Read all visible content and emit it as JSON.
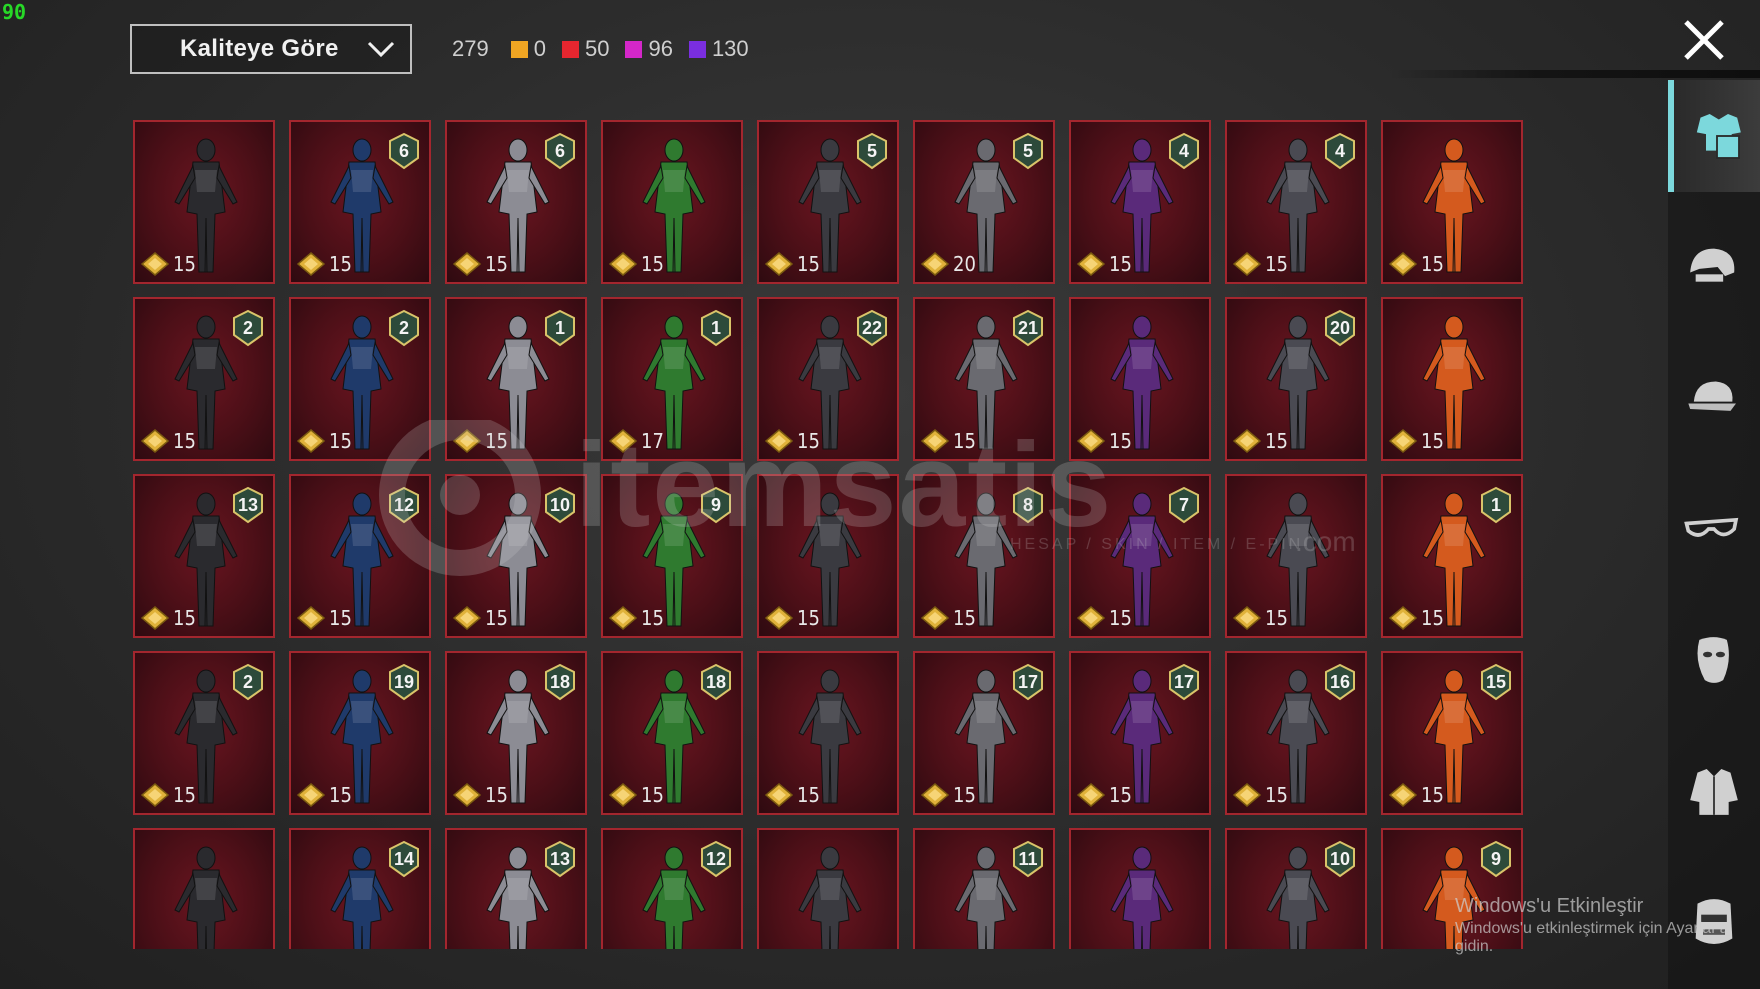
{
  "hud": {
    "fps": "90"
  },
  "sort": {
    "label": "Kaliteye Göre"
  },
  "counts": {
    "total": "279",
    "rarity": [
      {
        "color": "#f0a623",
        "value": "0"
      },
      {
        "color": "#e5262f",
        "value": "50"
      },
      {
        "color": "#d427c9",
        "value": "96"
      },
      {
        "color": "#7a2ee0",
        "value": "130"
      }
    ]
  },
  "items": [
    {
      "badge": "",
      "price": "15"
    },
    {
      "badge": "6",
      "price": "15"
    },
    {
      "badge": "6",
      "price": "15"
    },
    {
      "badge": "",
      "price": "15"
    },
    {
      "badge": "5",
      "price": "15"
    },
    {
      "badge": "5",
      "price": "20"
    },
    {
      "badge": "4",
      "price": "15"
    },
    {
      "badge": "4",
      "price": "15"
    },
    {
      "badge": "",
      "price": "15"
    },
    {
      "badge": "2",
      "price": "15"
    },
    {
      "badge": "2",
      "price": "15"
    },
    {
      "badge": "1",
      "price": "15"
    },
    {
      "badge": "1",
      "price": "17"
    },
    {
      "badge": "22",
      "price": "15"
    },
    {
      "badge": "21",
      "price": "15"
    },
    {
      "badge": "",
      "price": "15"
    },
    {
      "badge": "20",
      "price": "15"
    },
    {
      "badge": "",
      "price": "15"
    },
    {
      "badge": "13",
      "price": "15"
    },
    {
      "badge": "12",
      "price": "15"
    },
    {
      "badge": "10",
      "price": "15"
    },
    {
      "badge": "9",
      "price": "15"
    },
    {
      "badge": "",
      "price": "15"
    },
    {
      "badge": "8",
      "price": "15"
    },
    {
      "badge": "7",
      "price": "15"
    },
    {
      "badge": "",
      "price": "15"
    },
    {
      "badge": "1",
      "price": "15"
    },
    {
      "badge": "2",
      "price": "15"
    },
    {
      "badge": "19",
      "price": "15"
    },
    {
      "badge": "18",
      "price": "15"
    },
    {
      "badge": "18",
      "price": "15"
    },
    {
      "badge": "",
      "price": "15"
    },
    {
      "badge": "17",
      "price": "15"
    },
    {
      "badge": "17",
      "price": "15"
    },
    {
      "badge": "16",
      "price": "15"
    },
    {
      "badge": "15",
      "price": "15"
    },
    {
      "badge": "",
      "price": ""
    },
    {
      "badge": "14",
      "price": ""
    },
    {
      "badge": "13",
      "price": ""
    },
    {
      "badge": "12",
      "price": ""
    },
    {
      "badge": "",
      "price": ""
    },
    {
      "badge": "11",
      "price": ""
    },
    {
      "badge": "",
      "price": ""
    },
    {
      "badge": "10",
      "price": ""
    },
    {
      "badge": "9",
      "price": ""
    }
  ],
  "sidebar": [
    {
      "icon": "outfit-icon",
      "active": true
    },
    {
      "icon": "helmet-icon",
      "active": false
    },
    {
      "icon": "cap-icon",
      "active": false
    },
    {
      "icon": "glasses-icon",
      "active": false
    },
    {
      "icon": "mask-icon",
      "active": false
    },
    {
      "icon": "jacket-icon",
      "active": false
    },
    {
      "icon": "face-icon",
      "active": false
    }
  ],
  "watermark": {
    "brand": "itemsatis",
    "sub": "HESAP / SKIN / ITEM / E-PIN",
    "tld": ".com"
  },
  "windows": {
    "title": "Windows'u Etkinleştir",
    "subtitle": "Windows'u etkinleştirmek için Ayarlar'a gidin."
  }
}
